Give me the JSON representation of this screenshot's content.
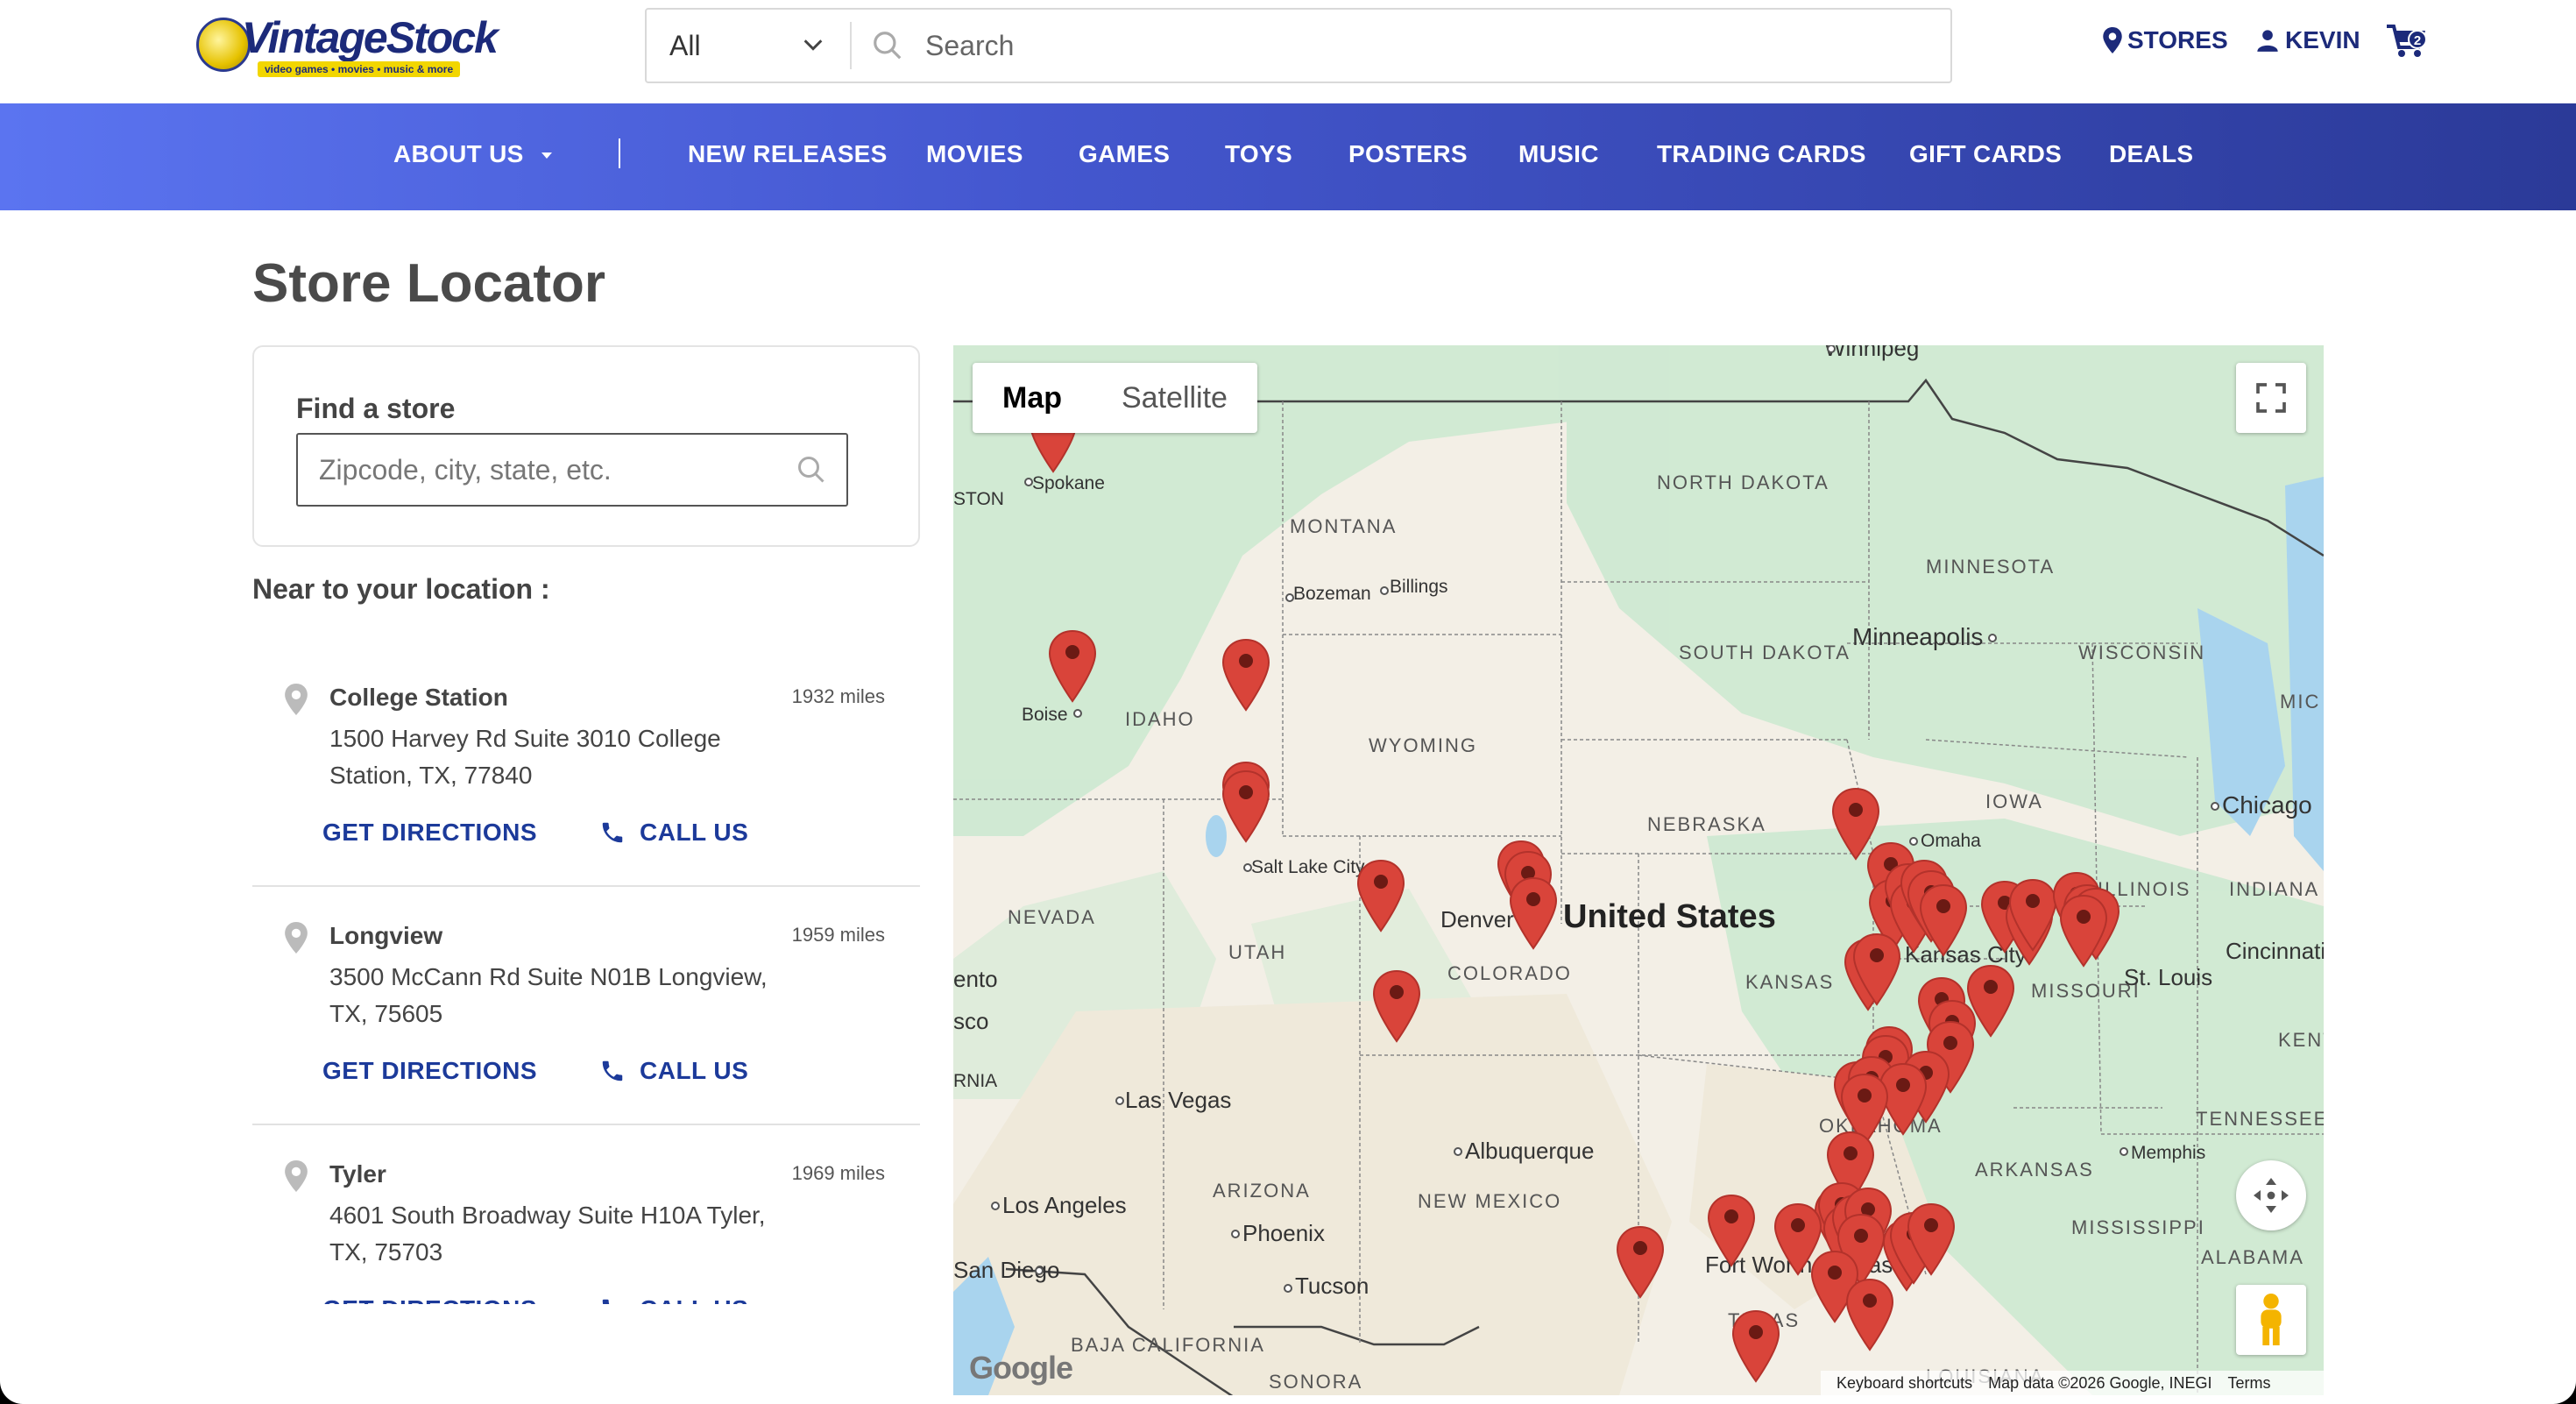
{
  "header": {
    "logo_text": "VintageStock",
    "logo_tagline": "video games • movies • music & more",
    "category_selected": "All",
    "search_placeholder": "Search",
    "stores_label": "STORES",
    "user_label": "KEVIN",
    "cart_count": "2"
  },
  "nav": {
    "items": [
      "ABOUT US",
      "|",
      "NEW RELEASES",
      "MOVIES",
      "GAMES",
      "TOYS",
      "POSTERS",
      "MUSIC",
      "TRADING CARDS",
      "GIFT CARDS",
      "DEALS"
    ]
  },
  "page": {
    "title": "Store Locator",
    "find_label": "Find a store",
    "find_placeholder": "Zipcode, city, state, etc.",
    "near_label": "Near to your location :"
  },
  "stores": [
    {
      "name": "College Station",
      "address": "1500 Harvey Rd Suite 3010 College Station, TX, 77840",
      "distance": "1932 miles",
      "directions": "GET DIRECTIONS",
      "call": "CALL US"
    },
    {
      "name": "Longview",
      "address": "3500 McCann Rd Suite N01B Longview, TX, 75605",
      "distance": "1959 miles",
      "directions": "GET DIRECTIONS",
      "call": "CALL US"
    },
    {
      "name": "Tyler",
      "address": "4601 South Broadway Suite H10A Tyler, TX, 75703",
      "distance": "1969 miles",
      "directions": "GET DIRECTIONS",
      "call": "CALL US"
    }
  ],
  "map": {
    "type_map": "Map",
    "type_satellite": "Satellite",
    "google": "Google",
    "footer_shortcuts": "Keyboard shortcuts",
    "footer_data": "Map data ©2026 Google, INEGI",
    "footer_terms": "Terms",
    "country_label": "United States",
    "states": [
      "NORTH DAKOTA",
      "SOUTH DAKOTA",
      "MONTANA",
      "WYOMING",
      "IDAHO",
      "NEBRASKA",
      "IOWA",
      "MINNESOTA",
      "WISCONSIN",
      "ILLINOIS",
      "INDIANA",
      "MISSOURI",
      "KANSAS",
      "OKLAHOMA",
      "TEXAS",
      "COLORADO",
      "UTAH",
      "NEVADA",
      "ARIZONA",
      "NEW MEXICO",
      "ARKANSAS",
      "TENNESSEE",
      "MISSISSIPPI",
      "ALABAMA",
      "KENT",
      "MIC",
      "SONORA",
      "BAJA CALIFORNIA",
      "LOUISIANA"
    ],
    "cities": [
      "Winnipeg",
      "Spokane",
      "Bozeman",
      "Billings",
      "Minneapolis",
      "Boise",
      "Omaha",
      "Chicago",
      "Salt Lake City",
      "Denver",
      "Kansas City",
      "St. Louis",
      "Cincinnati",
      "Las Vegas",
      "Albuquerque",
      "Memphis",
      "Los Angeles",
      "Phoenix",
      "Tucson",
      "San Diego",
      "Fort Worth",
      "Dallas",
      "ento",
      "sco",
      "RNIA",
      "STON"
    ],
    "colors": {
      "marker": "#d9443a",
      "land": "#f3efe6",
      "water": "#a9d4ee",
      "forest": "#cfe9d2"
    }
  }
}
